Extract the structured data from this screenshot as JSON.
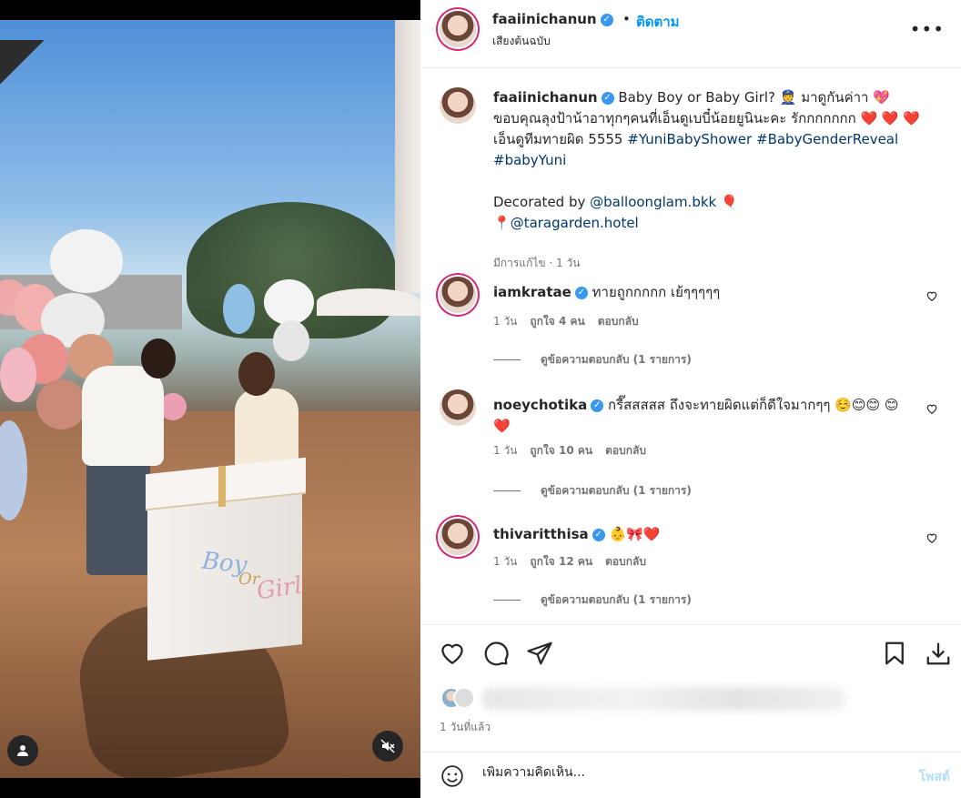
{
  "post": {
    "username": "faaiinichanun",
    "follow_label": "ติดตาม",
    "dot": "•",
    "subtitle": "เสียงต้นฉบับ",
    "more": "•••"
  },
  "caption": {
    "username": "faaiinichanun",
    "line1": "Baby Boy or Baby Girl? 👮 มาดูกันค่าา 💖",
    "line2": "ขอบคุณลุงป้าน้าอาทุกๆคนที่เอ็นดูเบบี๋น้อยยูนินะคะ รักกกกกกก ❤️ ❤️ ❤️",
    "line3": "เอ็นดูทีมทายผิด 5555",
    "hashtags": [
      "#YuniBabyShower",
      "#BabyGenderReveal",
      "#babyYuni"
    ],
    "decorated": "Decorated by",
    "decorated_tag": "@balloonglam.bkk",
    "balloon_emoji": "🎈",
    "location_pin": "📍",
    "location_tag": "@taragarden.hotel",
    "meta": "มีการแก้ไข · 1 วัน"
  },
  "comments": [
    {
      "username": "iamkratae",
      "text": "ทายถูกกกกก เย้ๆๆๆๆๆ",
      "time": "1 วัน",
      "likes": "ถูกใจ 4 คน",
      "reply": "ตอบกลับ",
      "view_replies": "ดูข้อความตอบกลับ (1 รายการ)"
    },
    {
      "username": "noeychotika",
      "text": "กรี๊สสสสส ถึงจะทายผิดแต่ก็ดีใจมากๆๆ ☺️😊😊 😊❤️",
      "time": "1 วัน",
      "likes": "ถูกใจ 10 คน",
      "reply": "ตอบกลับ",
      "view_replies": "ดูข้อความตอบกลับ (1 รายการ)"
    },
    {
      "username": "thivaritthisa",
      "text": "👶🎀❤️",
      "time": "1 วัน",
      "likes": "ถูกใจ 12 คน",
      "reply": "ตอบกลับ",
      "view_replies": "ดูข้อความตอบกลับ (1 รายการ)"
    }
  ],
  "footer": {
    "time_ago": "1 วันที่แล้ว",
    "add_comment_placeholder": "เพิ่มความคิดเห็น...",
    "post_label": "โพสต์"
  },
  "media": {
    "box_text_boy": "Boy",
    "box_text_or": "Or",
    "box_text_girl": "Girl"
  },
  "colors": {
    "accent": "#0095f6",
    "verified": "#3897f0",
    "post_disabled": "#b2dffc",
    "hashtag": "#00376b",
    "muted": "#737373"
  }
}
